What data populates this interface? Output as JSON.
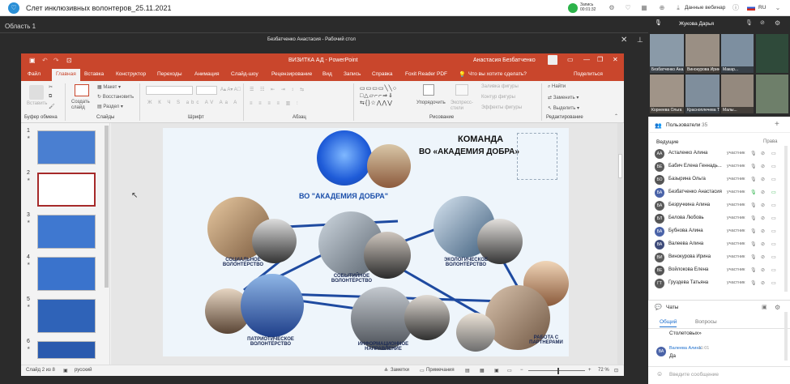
{
  "topbar": {
    "title": "Слет инклюзивных волонтеров_25.11.2021",
    "rec_label": "Запись",
    "rec_time": "00:01:32",
    "webinar_data": "Данные вебинар",
    "lang": "RU"
  },
  "window": {
    "area": "Область 1",
    "rdp_title": "Безбатченко Анастасия - Рабочий стол"
  },
  "ppt": {
    "title": "ВИЗИТКА АД - PowerPoint",
    "user": "Анастасия Безбатченко",
    "tabs": [
      "Файл",
      "Главная",
      "Вставка",
      "Конструктор",
      "Переходы",
      "Анимация",
      "Слайд-шоу",
      "Рецензирование",
      "Вид",
      "Запись",
      "Справка",
      "Foxit Reader PDF"
    ],
    "tell_me": "Что вы хотите сделать?",
    "share": "Поделиться",
    "ribbon": {
      "paste": "Вставить",
      "create_slide": "Создать слайд",
      "layout": "Макет",
      "reset": "Восстановить",
      "section": "Раздел",
      "arrange": "Упорядочить",
      "quick_styles": "Экспресс-стили",
      "shape_fill": "Заливка фигуры",
      "shape_outline": "Контур фигуры",
      "shape_effects": "Эффекты фигуры",
      "find": "Найти",
      "replace": "Заменить",
      "select": "Выделить"
    },
    "groups": {
      "clipboard": "Буфер обмена",
      "slides": "Слайды",
      "font": "Шрифт",
      "paragraph": "Абзац",
      "drawing": "Рисование",
      "editing": "Редактирование"
    },
    "slide_numbers": [
      "1",
      "2",
      "3",
      "4",
      "5",
      "6"
    ],
    "status": {
      "slide": "Слайд 2 из 8",
      "lang": "русский",
      "notes": "Заметки",
      "comments": "Примечания",
      "zoom": "72 %"
    }
  },
  "slide": {
    "heading1": "КОМАНДА",
    "heading2": "ВО «АКАДЕМИЯ ДОБРА»",
    "center_label": "ВО \"АКАДЕМИЯ ДОБРА\"",
    "labels": {
      "social": "СОЦИАЛЬНОЕ ВОЛОНТЁРСТВО",
      "event": "СОБЫТИЙНОЕ ВОЛОНТЁРСТВО",
      "eco": "ЭКОЛОГИЧЕСКОЕ ВОЛОНТЁРСТВО",
      "patriot": "ПАТРИОТИЧЕСКОЕ ВОЛОНТЁРСТВО",
      "info": "ИНФОРМАЦИОННОЕ НАПРАВЛЕНИЕ",
      "partners": "РАБОТА С ПАРТНЕРАМИ"
    }
  },
  "right": {
    "host": "Жукова Дарья",
    "videos": [
      "Безбатченко Ана...",
      "Винокурова Ирина",
      "Макар...",
      "Корнеева Ольга",
      "Красноплечева Т...",
      "Малы..."
    ],
    "users_title": "Пользователи",
    "users_count": "35",
    "leads": "Ведущие",
    "rights": "Права",
    "users": [
      {
        "init": "АА",
        "name": "Асталенко Алина",
        "role": "участник"
      },
      {
        "init": "БЕ",
        "name": "Бабич Елена Геннадь...",
        "role": "участник"
      },
      {
        "init": "БО",
        "name": "Базырина Ольга",
        "role": "участник"
      },
      {
        "init": "БА",
        "name": "Безбатченко Анастасия",
        "role": "участник"
      },
      {
        "init": "БА",
        "name": "Безручкина Алина",
        "role": "участник"
      },
      {
        "init": "БЛ",
        "name": "Белова Любовь",
        "role": "участник"
      },
      {
        "init": "БА",
        "name": "Бубнова Алина",
        "role": "участник"
      },
      {
        "init": "ВА",
        "name": "Валеева Алина",
        "role": "участник"
      },
      {
        "init": "ВИ",
        "name": "Винокурова Ирина",
        "role": "участник"
      },
      {
        "init": "ВЕ",
        "name": "Войлокова Елена",
        "role": "участник"
      },
      {
        "init": "ГТ",
        "name": "Груздева Татьяна",
        "role": "участник"
      }
    ],
    "chats_title": "Чаты",
    "chat_tabs": [
      "Общий",
      "Вопросы"
    ],
    "chat_prev": "Столетовых»",
    "chat_author": "Валеева Алина",
    "chat_time": "11:01",
    "chat_msg": "Да",
    "chat_init": "ВА",
    "input_placeholder": "Введите сообщение"
  }
}
